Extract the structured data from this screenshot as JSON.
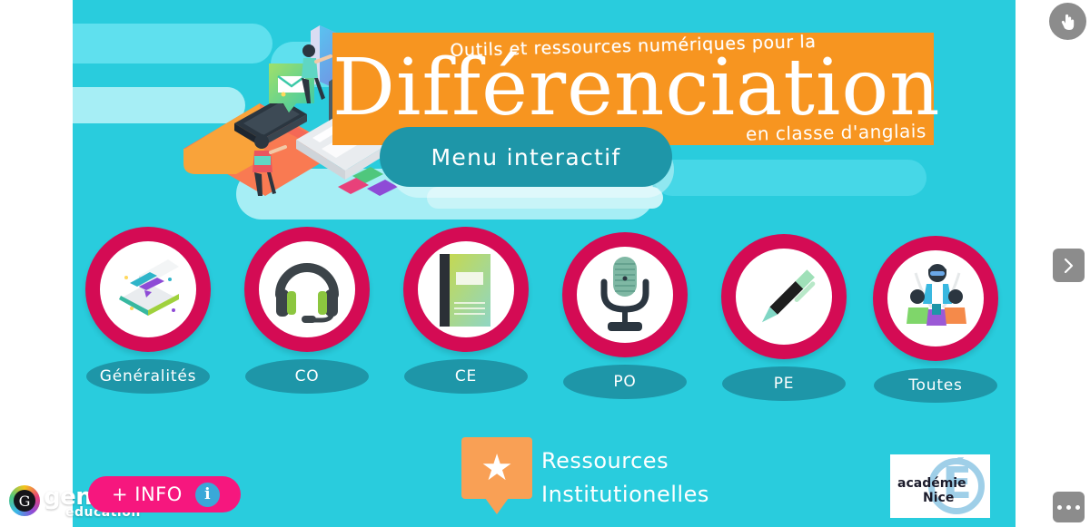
{
  "colors": {
    "background": "#29ccdd",
    "accent_orange": "#f79520",
    "accent_teal": "#1e96a8",
    "accent_crimson": "#d40b54",
    "accent_pink": "#f6177e",
    "cloud_light": "#5fe0ee",
    "cloud_pale": "#a6eef5"
  },
  "header": {
    "tagline": "Outils et ressources numériques pour la",
    "title": "Différenciation",
    "subtitle": "en classe d'anglais"
  },
  "menu_button": {
    "label": "Menu interactif"
  },
  "icon_menu": [
    {
      "key": "generalites",
      "label": "Généralités",
      "icon": "open-book-icon"
    },
    {
      "key": "co",
      "label": "CO",
      "icon": "headset-icon"
    },
    {
      "key": "ce",
      "label": "CE",
      "icon": "closed-book-icon"
    },
    {
      "key": "po",
      "label": "PO",
      "icon": "microphone-icon"
    },
    {
      "key": "pe",
      "label": "PE",
      "icon": "pen-icon"
    },
    {
      "key": "toutes",
      "label": "Toutes",
      "icon": "people-group-icon"
    }
  ],
  "resources": {
    "line1": "Ressources",
    "line2": "Institutionelles",
    "icon": "star-bubble-icon"
  },
  "branding": {
    "genially_name": "genially",
    "genially_sub": "education",
    "info_label": "+ INFO",
    "info_icon": "info-icon"
  },
  "academie": {
    "line1": "académie",
    "line2": "Nice",
    "emblem": "É"
  },
  "controls": {
    "hand_icon": "hand-pointer-icon",
    "next_icon": "chevron-right-icon",
    "more_icon": "ellipsis-icon"
  }
}
